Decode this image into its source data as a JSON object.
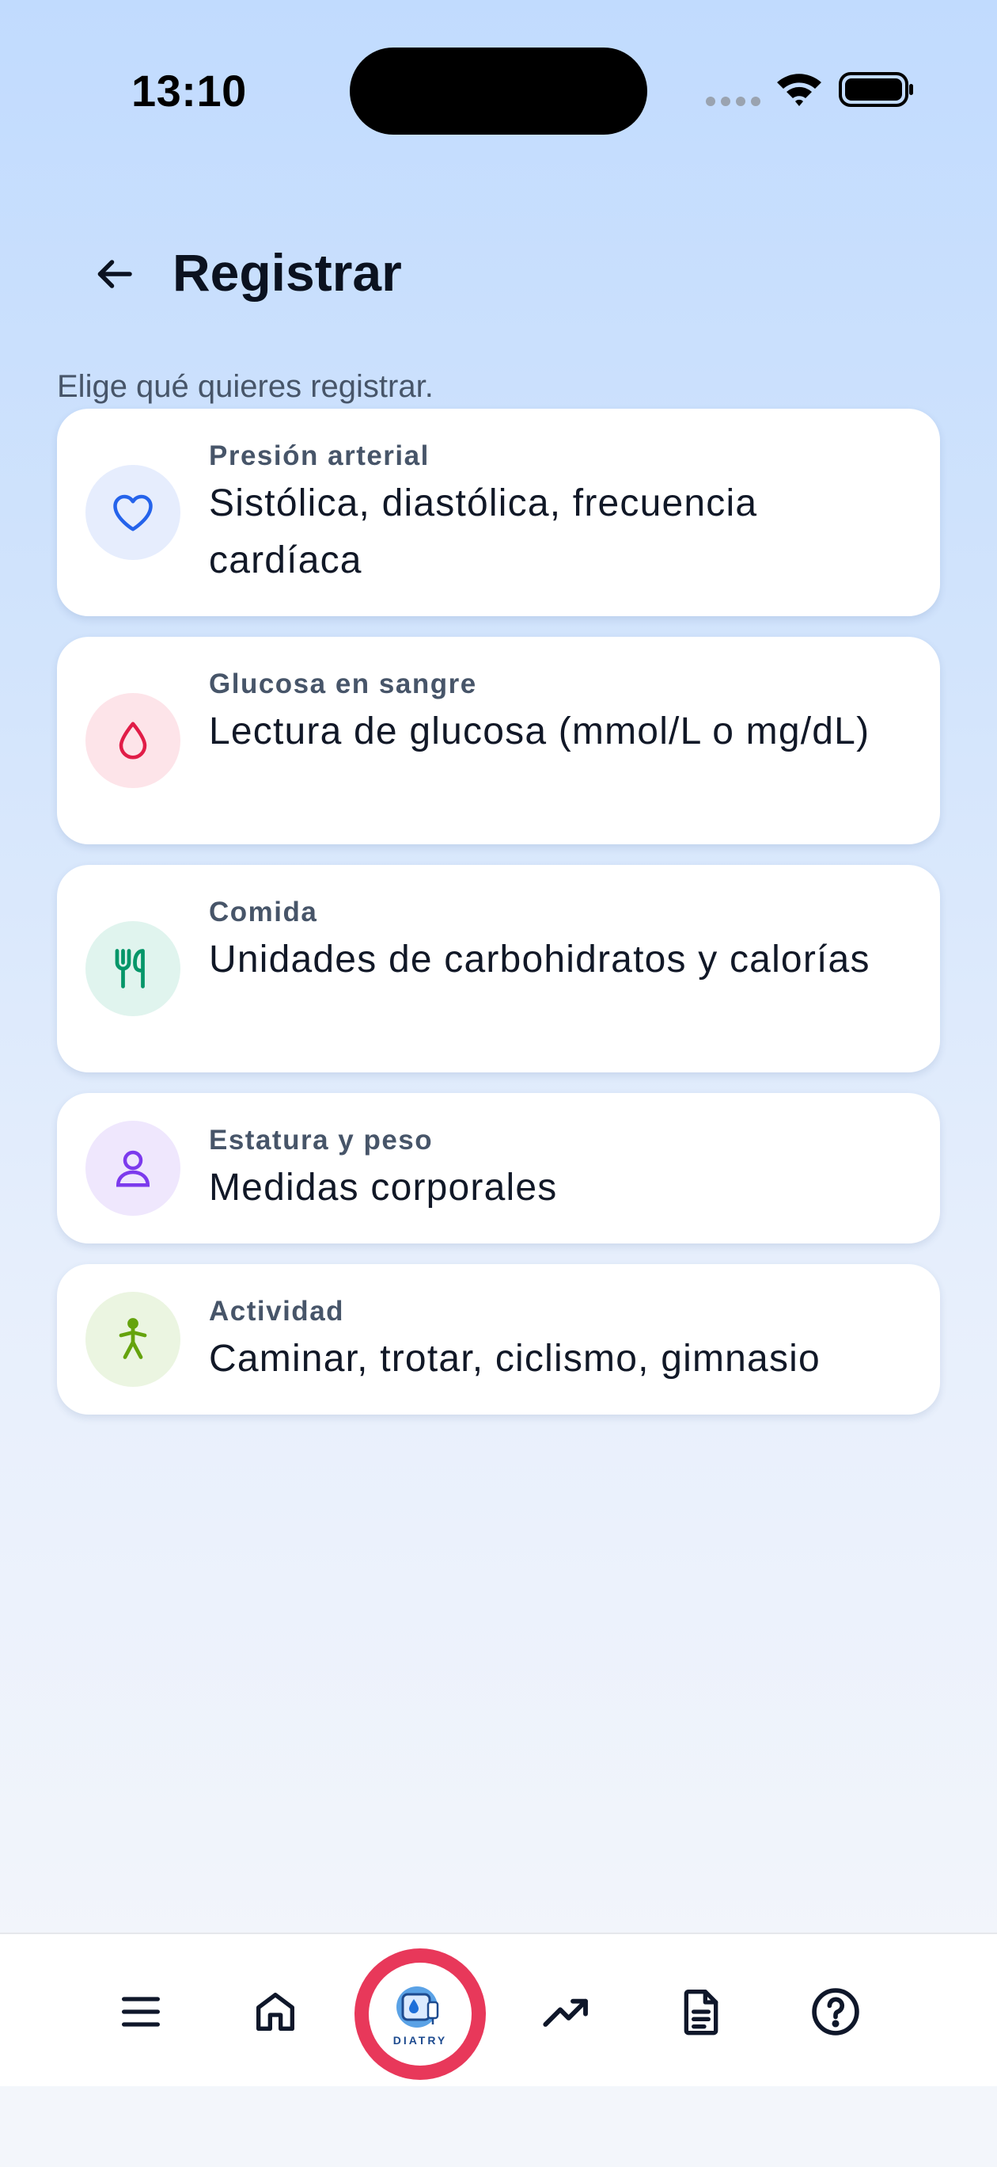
{
  "status_bar": {
    "time": "13:10"
  },
  "header": {
    "title": "Registrar"
  },
  "subtitle": "Elige qué quieres registrar.",
  "cards": [
    {
      "label": "Presión arterial",
      "description": "Sistólica, diastólica, frecuencia cardíaca",
      "icon": "heart-icon",
      "icon_color": "#2563eb",
      "icon_bg": "#e6edfd"
    },
    {
      "label": "Glucosa en sangre",
      "description": "Lectura de glucosa (mmol/L o mg/dL)",
      "icon": "drop-icon",
      "icon_color": "#e11d48",
      "icon_bg": "#fde4e9"
    },
    {
      "label": "Comida",
      "description": "Unidades de carbohidratos y calorías",
      "icon": "utensils-icon",
      "icon_color": "#059669",
      "icon_bg": "#e0f4ee"
    },
    {
      "label": "Estatura y peso",
      "description": "Medidas corporales",
      "icon": "person-icon",
      "icon_color": "#7c3aed",
      "icon_bg": "#efe7fd"
    },
    {
      "label": "Actividad",
      "description": "Caminar, trotar, ciclismo, gimnasio",
      "icon": "walking-icon",
      "icon_color": "#65a30d",
      "icon_bg": "#ebf5e1"
    }
  ],
  "bottom_nav": {
    "items": [
      "menu-icon",
      "home-icon",
      "diatry-logo",
      "trending-icon",
      "document-icon",
      "help-icon"
    ],
    "logo_text": "DIATRY",
    "accent": "#e8385a"
  }
}
